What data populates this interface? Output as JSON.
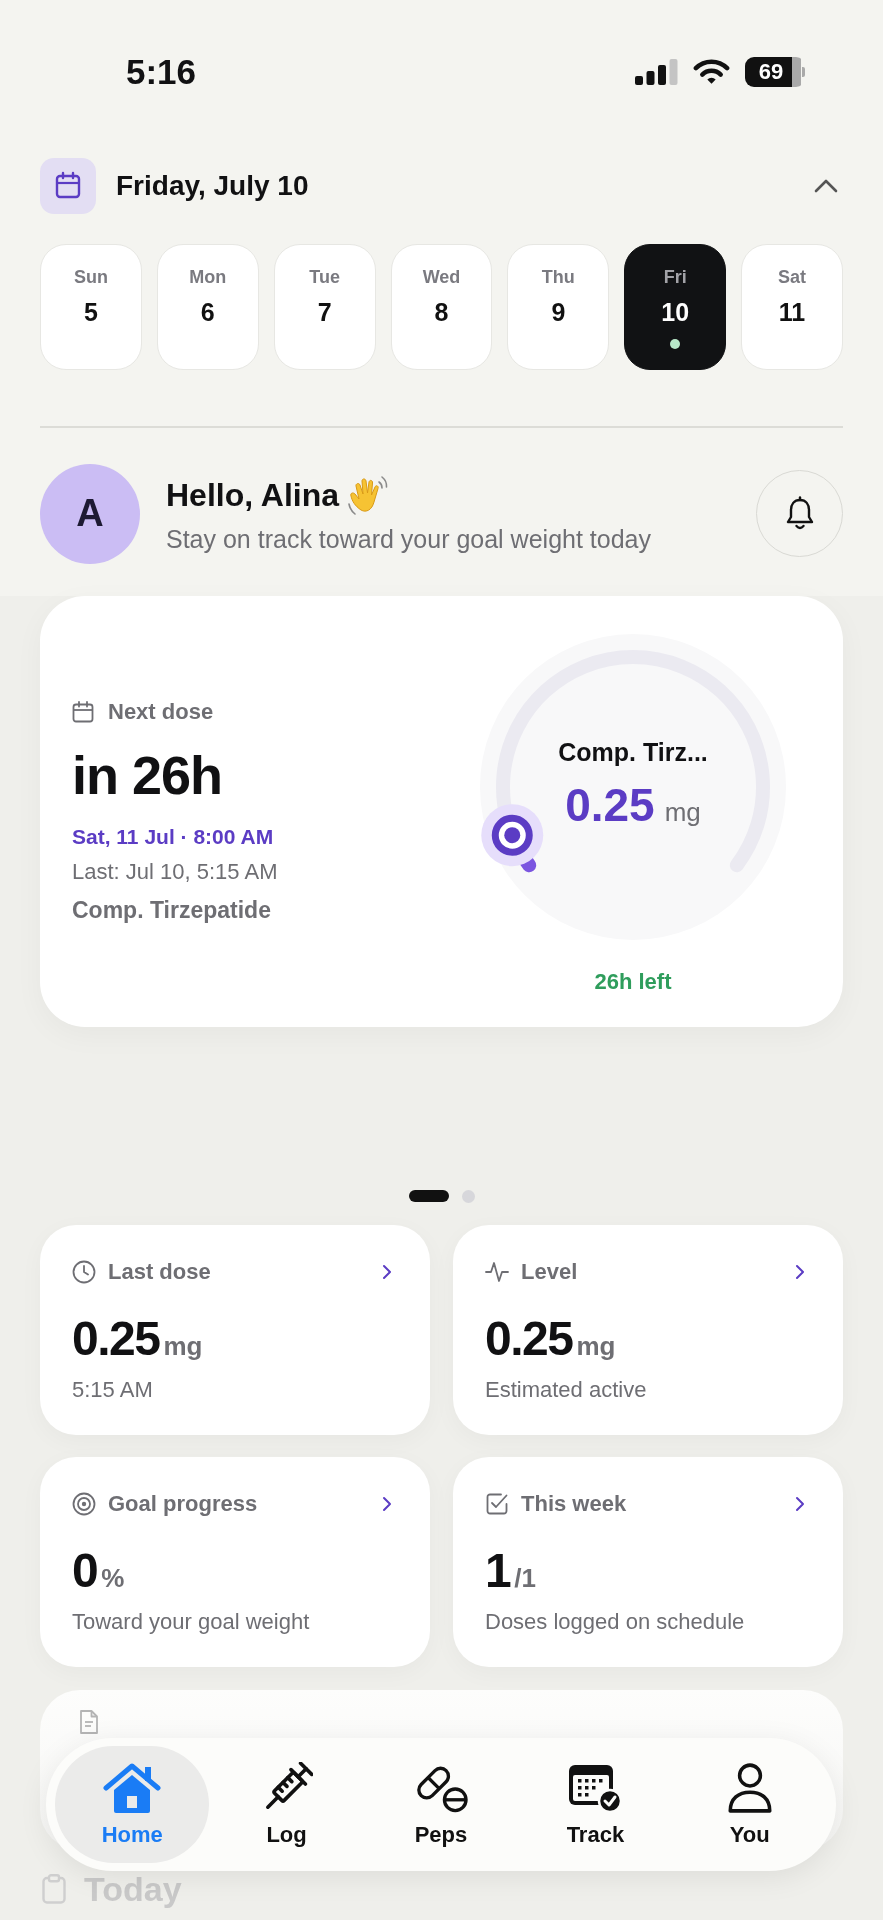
{
  "status_bar": {
    "time": "5:16",
    "battery": "69"
  },
  "date_header": {
    "title": "Friday, July 10",
    "expanded": true
  },
  "days": [
    {
      "name": "Sun",
      "number": "5",
      "selected": false,
      "dose_logged": false
    },
    {
      "name": "Mon",
      "number": "6",
      "selected": false,
      "dose_logged": false
    },
    {
      "name": "Tue",
      "number": "7",
      "selected": false,
      "dose_logged": false
    },
    {
      "name": "Wed",
      "number": "8",
      "selected": false,
      "dose_logged": false
    },
    {
      "name": "Thu",
      "number": "9",
      "selected": false,
      "dose_logged": false
    },
    {
      "name": "Fri",
      "number": "10",
      "selected": true,
      "dose_logged": true
    },
    {
      "name": "Sat",
      "number": "11",
      "selected": false,
      "dose_logged": false
    }
  ],
  "greeting": {
    "avatar_initial": "A",
    "title": "Hello, Alina",
    "subtitle": "Stay on track toward your goal weight today"
  },
  "next_dose": {
    "label": "Next dose",
    "countdown": "in 26h",
    "scheduled": "Sat, 11 Jul · 8:00 AM",
    "last": "Last: Jul 10, 5:15 AM",
    "medication": "Comp. Tirzepatide",
    "gauge": {
      "title": "Comp. Tirz...",
      "value": "0.25",
      "unit": "mg",
      "level": 0.06
    },
    "remaining": "26h left"
  },
  "pager": [
    {
      "selected": true
    },
    {
      "selected": false
    }
  ],
  "stats": [
    {
      "kind": "last_dose",
      "title": "Last dose",
      "value": "0.25",
      "unit": "mg",
      "caption": "5:15 AM"
    },
    {
      "kind": "level",
      "title": "Level",
      "value": "0.25",
      "unit": "mg",
      "caption": "Estimated active"
    },
    {
      "kind": "goal",
      "title": "Goal progress",
      "value": "0",
      "unit": "%",
      "caption": "Toward your goal weight"
    },
    {
      "kind": "week",
      "title": "This week",
      "value": "1",
      "unit": "/1",
      "caption": "Doses logged on schedule"
    }
  ],
  "section": {
    "title": "Today"
  },
  "tab_bar": [
    {
      "label": "Home",
      "selected": true
    },
    {
      "label": "Log",
      "selected": false
    },
    {
      "label": "Peps",
      "selected": false
    },
    {
      "label": "Track",
      "selected": false
    },
    {
      "label": "You",
      "selected": false
    }
  ]
}
